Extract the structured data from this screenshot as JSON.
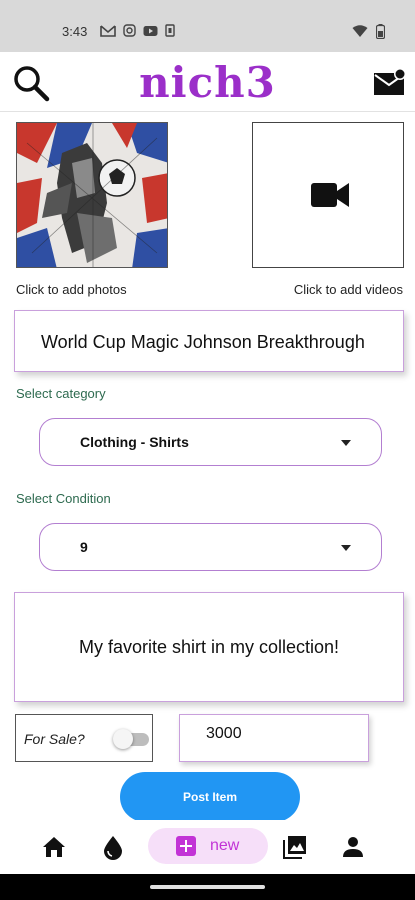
{
  "status_bar": {
    "time": "3:43",
    "notification_icons": [
      "gmail-icon",
      "instagram-icon",
      "youtube-icon",
      "sim-icon"
    ],
    "right_icons": [
      "wifi-icon",
      "battery-icon"
    ]
  },
  "header": {
    "brand": "nich3",
    "brand_color": "#9b2fc9",
    "search_icon": "search-icon",
    "mail_icon": "mail-notification-icon"
  },
  "media": {
    "photo_thumbnail": "shirt-photo",
    "add_photos_label": "Click to add photos",
    "video_icon": "video-camera-icon",
    "add_videos_label": "Click to add videos"
  },
  "form": {
    "title_value": "World Cup Magic Johnson Breakthrough",
    "category_label": "Select category",
    "category_value": "Clothing - Shirts",
    "condition_label": "Select Condition",
    "condition_value": "9",
    "description_value": "My favorite shirt in my collection!",
    "for_sale_label": "For Sale?",
    "for_sale_on": false,
    "price_value": "3000",
    "post_button": "Post Item",
    "post_button_color": "#2196f3"
  },
  "bottom_nav": {
    "items": [
      "home-icon",
      "drop-icon",
      "new",
      "gallery-icon",
      "profile-icon"
    ],
    "new_label": "new",
    "accent": "#c233d6"
  }
}
